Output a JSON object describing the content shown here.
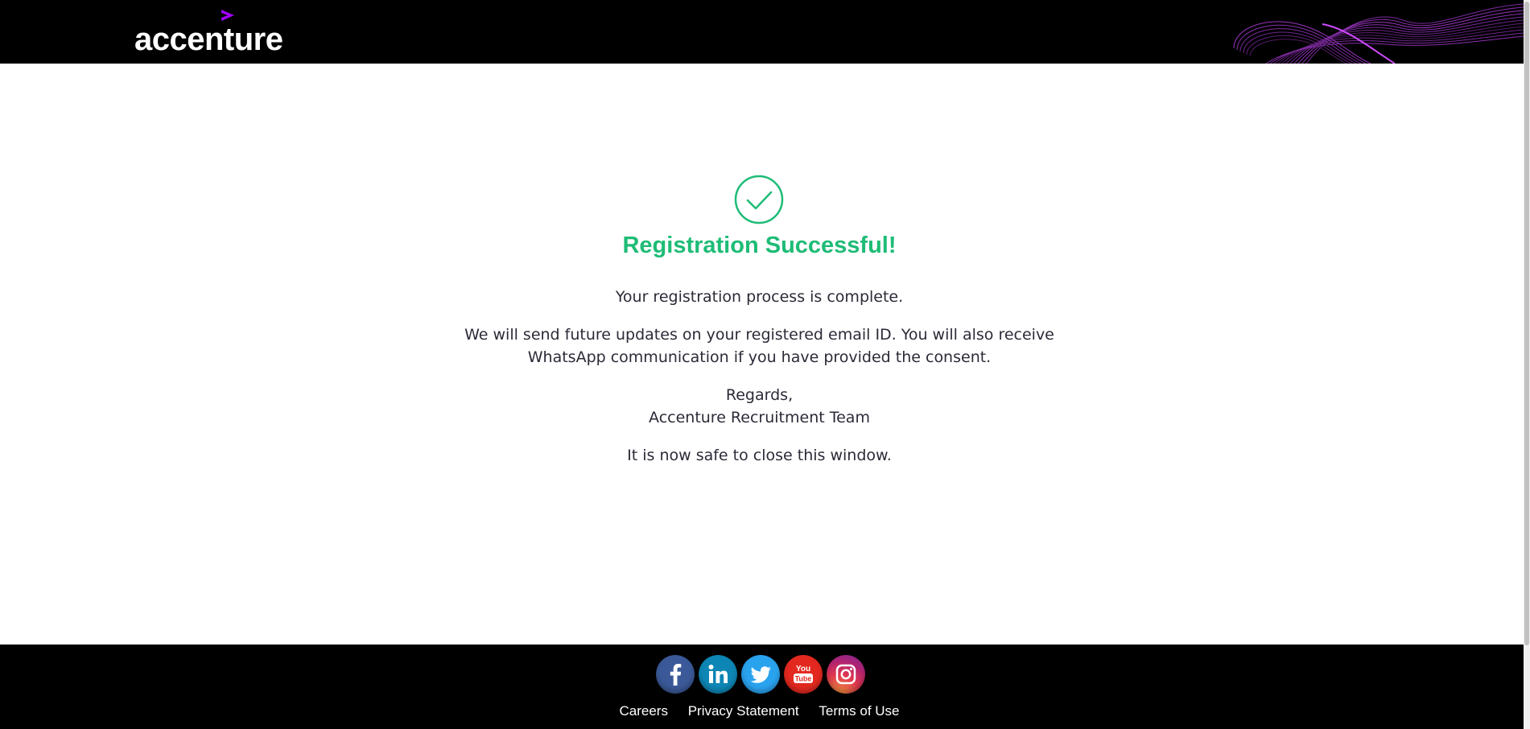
{
  "header": {
    "logo_text": "accenture",
    "logo_mark": ">"
  },
  "main": {
    "icon": "check-circle-icon",
    "title": "Registration Successful!",
    "line1": "Your registration process is complete.",
    "line2a": "We will send future updates on your registered email ID. You will also receive",
    "line2b": "WhatsApp communication if you have provided the consent.",
    "regards": "Regards,",
    "team": "Accenture Recruitment Team",
    "close_note": "It is now safe to close this window."
  },
  "footer": {
    "social": [
      {
        "name": "facebook-icon",
        "glyph": "f"
      },
      {
        "name": "linkedin-icon",
        "glyph": "in"
      },
      {
        "name": "twitter-icon",
        "glyph": "bird"
      },
      {
        "name": "youtube-icon",
        "glyph": "You Tube"
      },
      {
        "name": "instagram-icon",
        "glyph": "camera"
      }
    ],
    "links": [
      "Careers",
      "Privacy Statement",
      "Terms of Use"
    ]
  },
  "colors": {
    "accent_green": "#1ebc76",
    "brand_purple": "#a100ff",
    "header_bg": "#000000",
    "text": "#2b2b38"
  }
}
